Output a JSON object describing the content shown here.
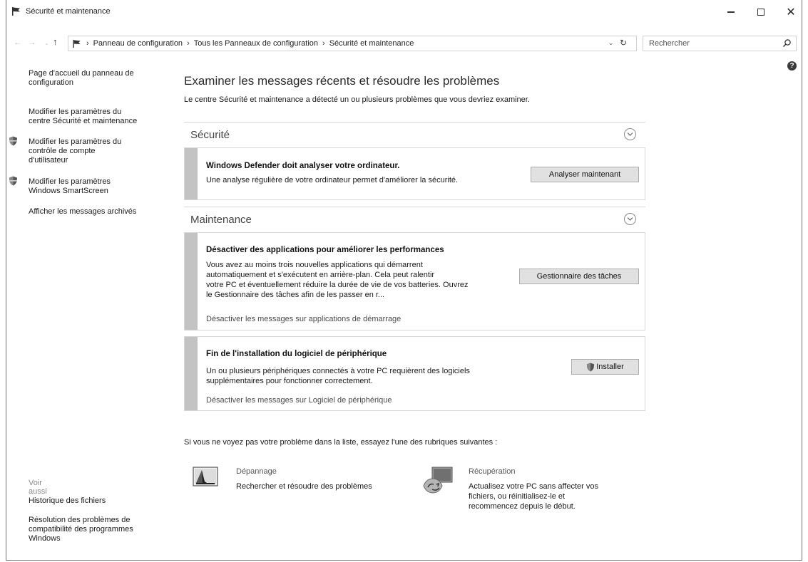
{
  "window": {
    "title": "Sécurité et maintenance",
    "controls": {
      "minimize": "minimize-icon",
      "maximize": "maximize-icon",
      "close": "close-icon"
    }
  },
  "address": {
    "breadcrumb": [
      "Panneau de configuration",
      "Tous les Panneaux de configuration",
      "Sécurité et maintenance"
    ],
    "separator": "›",
    "search_placeholder": "Rechercher"
  },
  "help": {
    "label": "?"
  },
  "sidebar": {
    "links": [
      {
        "label_line1": "Page d'accueil du panneau de",
        "label_line2": "configuration",
        "shield": false
      },
      {
        "label_line1": "Modifier les paramètres du",
        "label_line2": "centre Sécurité et maintenance",
        "shield": false
      },
      {
        "label_line1": "Modifier les paramètres du",
        "label_line2": "contrôle de compte",
        "label_line3": "d'utilisateur",
        "shield": true
      },
      {
        "label_line1": "Modifier les paramètres",
        "label_line2": "Windows SmartScreen",
        "shield": true
      },
      {
        "label_line1": "Afficher les messages archivés",
        "shield": false
      }
    ],
    "see_also_label": "Voir aussi",
    "see_also": [
      {
        "label_line1": "Historique des fichiers"
      },
      {
        "label_line1": "Résolution des problèmes de",
        "label_line2": "compatibilité des programmes",
        "label_line3": "Windows"
      }
    ]
  },
  "main": {
    "title": "Examiner les messages récents et résoudre les problèmes",
    "subtitle": "Le centre Sécurité et maintenance a détecté un ou plusieurs problèmes que vous devriez examiner.",
    "sections": {
      "security": {
        "label": "Sécurité",
        "card": {
          "title": "Windows Defender doit analyser votre ordinateur.",
          "text": "Une analyse régulière de votre ordinateur permet d'améliorer la sécurité.",
          "button": "Analyser maintenant"
        }
      },
      "maintenance": {
        "label": "Maintenance",
        "card1": {
          "title": "Désactiver des applications pour améliorer les performances",
          "text_lines": [
            "Vous avez au moins trois nouvelles applications qui démarrent",
            "automatiquement et s'exécutent en arrière-plan. Cela peut ralentir",
            "votre PC et éventuellement réduire la durée de vie de vos batteries. Ouvrez",
            "le Gestionnaire des tâches afin de les passer en r..."
          ],
          "link": "Désactiver les messages sur applications de démarrage",
          "button": "Gestionnaire des tâches"
        },
        "card2": {
          "title": "Fin de l'installation du logiciel de périphérique",
          "text_lines": [
            "Un ou plusieurs périphériques connectés à votre PC requièrent des logiciels",
            "supplémentaires pour fonctionner correctement."
          ],
          "link": "Désactiver les messages sur Logiciel de périphérique",
          "button": "Installer"
        }
      }
    },
    "bottom_prompt": "Si vous ne voyez pas votre problème dans la liste, essayez l'une des rubriques suivantes :",
    "tools": [
      {
        "title": "Dépannage",
        "desc_lines": [
          "Rechercher et résoudre des problèmes"
        ],
        "icon": "troubleshooting-icon"
      },
      {
        "title": "Récupération",
        "desc_lines": [
          "Actualisez votre PC sans affecter vos",
          "fichiers, ou réinitialisez-le et",
          "recommencez depuis le début."
        ],
        "icon": "recovery-icon"
      }
    ]
  }
}
